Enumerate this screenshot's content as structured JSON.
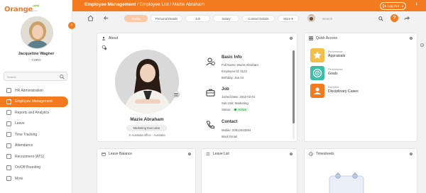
{
  "app": {
    "logo_text": "range",
    "logo_suffix": "HRM",
    "tagline": "Human Resource Management"
  },
  "user": {
    "name": "Jacqueline Wagner",
    "role": "CHRO"
  },
  "sidebar": {
    "search_placeholder": "Search",
    "items": [
      {
        "label": "HR Administration",
        "icon": "hr-admin-icon",
        "active": false
      },
      {
        "label": "Employee Management",
        "icon": "employee-icon",
        "active": true
      },
      {
        "label": "Reports and Analytics",
        "icon": "reports-icon",
        "active": false
      },
      {
        "label": "Leave",
        "icon": "leave-icon",
        "active": false
      },
      {
        "label": "Time Tracking",
        "icon": "clock-icon",
        "active": false
      },
      {
        "label": "Attendance",
        "icon": "attendance-icon",
        "active": false
      },
      {
        "label": "Recruitment (ATS)",
        "icon": "recruitment-icon",
        "active": false
      },
      {
        "label": "On/Off Boarding",
        "icon": "onboarding-icon",
        "active": false
      },
      {
        "label": "More",
        "icon": "more-icon",
        "active": false
      }
    ]
  },
  "topbar": {
    "crumb_main": "Employee Management",
    "crumb_rest": " / Employee List / Mazie Abraham",
    "logout_label": "Log Out"
  },
  "tabs": {
    "items": [
      "Profile",
      "Personal Details",
      "Job",
      "Salary",
      "Contact Details",
      "More"
    ],
    "search_placeholder": "Search",
    "help_label": "?"
  },
  "about": {
    "title": "About",
    "employee_name": "Mazie Abraham",
    "designation": "Marketing Executive",
    "location": "Australia office - Australia",
    "basic_info": {
      "title": "Basic Info",
      "full_name": "Full Name: Mazie Abraham",
      "employee_id": "Employee Id: 0123",
      "birthday": "Birthday: Jan 24"
    },
    "job": {
      "title": "Job",
      "joined": "Joined Date: 2022-02-01",
      "sub_unit": "Sub Unit: Marketing",
      "status_label": "Status:",
      "status_value": "Active"
    },
    "contact": {
      "title": "Contact",
      "mobile": "Mobile: 00612643294",
      "work_email": "Work Email"
    }
  },
  "quick_access": {
    "title": "Quick Access",
    "items": [
      {
        "small": "Performance",
        "big": "Appraisals",
        "color": "#f2c04a",
        "icon": "star-icon"
      },
      {
        "small": "Performance",
        "big": "Goals",
        "color": "#3bbfa6",
        "icon": "target-icon"
      },
      {
        "small": "Discipline",
        "big": "Disciplinary Cases",
        "color": "#f47a1f",
        "icon": "case-icon"
      }
    ]
  },
  "widgets": {
    "leave_balance": "Leave Balance",
    "leave_list": "Leave List",
    "timesheets": "Timesheets"
  },
  "colors": {
    "accent": "#f47a1f",
    "active_tab": "#fbc8a8",
    "status_green": "#2f9a45"
  }
}
